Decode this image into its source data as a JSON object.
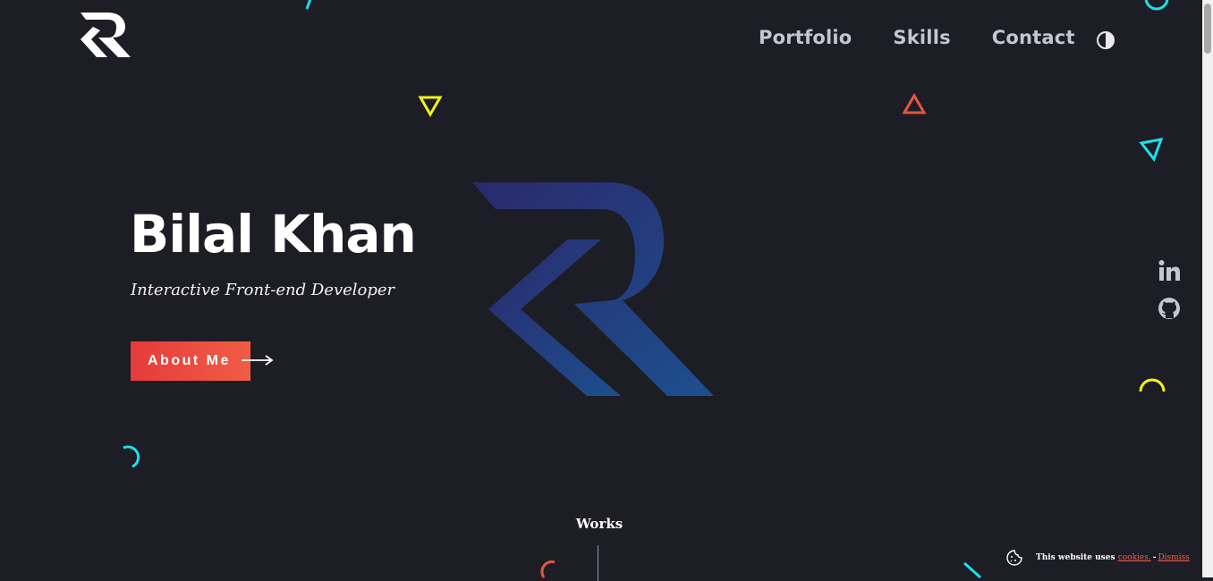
{
  "header": {
    "nav": [
      {
        "label": "Portfolio"
      },
      {
        "label": "Skills"
      },
      {
        "label": "Contact"
      }
    ]
  },
  "hero": {
    "name": "Bilal Khan",
    "subtitle": "Interactive Front-end Developer",
    "cta_label": "About Me"
  },
  "social": [
    "linkedin-icon",
    "github-icon"
  ],
  "works": {
    "label": "Works"
  },
  "cookie_bar": {
    "text": "This website uses",
    "link_label": "cookies.",
    "separator": "-",
    "dismiss_label": "Dismiss"
  },
  "colors": {
    "background": "#1d1d26",
    "accent_red": "#e63b3b",
    "accent_cyan": "#1de0e8",
    "accent_yellow": "#f2f21c",
    "accent_orange": "#e8553f",
    "logo_blue": "#243a78"
  }
}
